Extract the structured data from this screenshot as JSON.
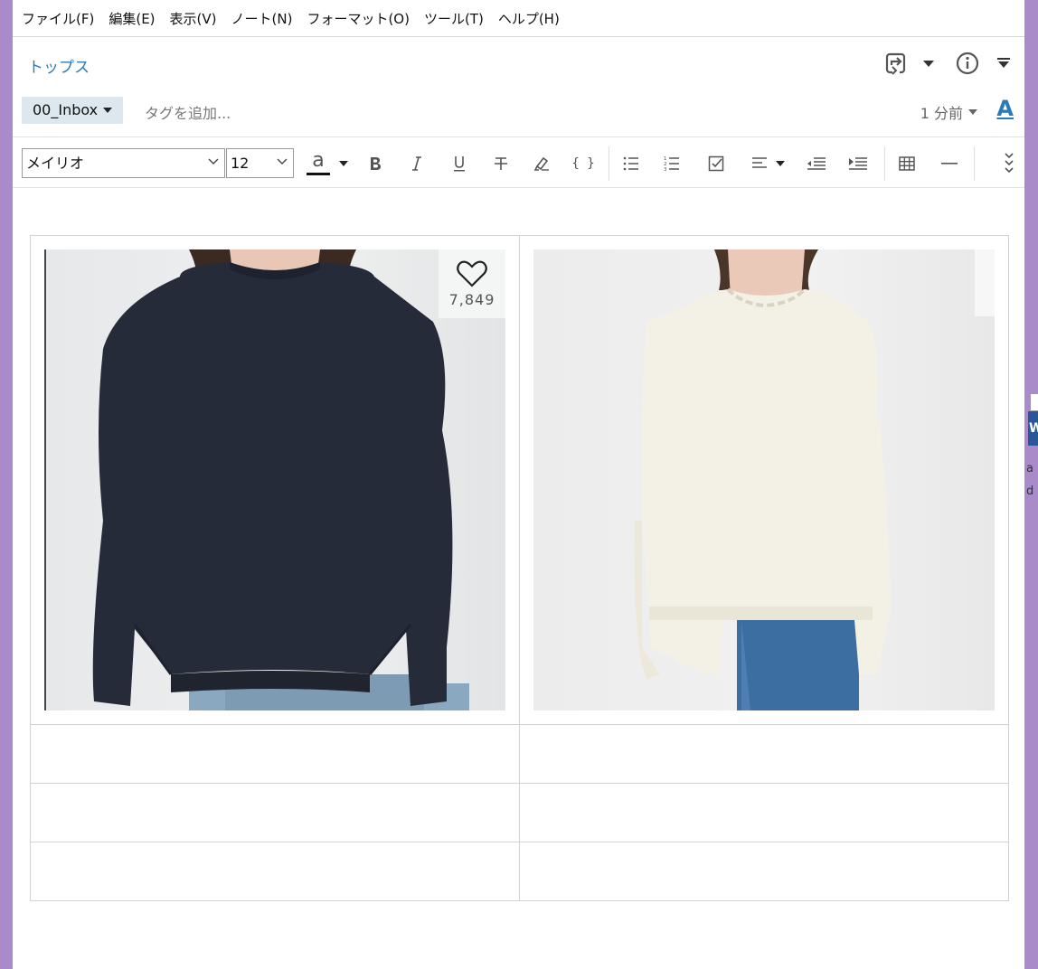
{
  "menu": {
    "items": [
      "ファイル(F)",
      "編集(E)",
      "表示(V)",
      "ノート(N)",
      "フォーマット(O)",
      "ツール(T)",
      "ヘルプ(H)"
    ]
  },
  "header": {
    "notebook": "トップス"
  },
  "tags": {
    "notebook_chip": "00_Inbox",
    "add_tag_placeholder": "タグを追加...",
    "updated": "1 分前",
    "font_icon_letter": "A"
  },
  "toolbar": {
    "font_family": "メイリオ",
    "font_size": "12",
    "text_color_letter": "a",
    "code_label": "{ }"
  },
  "note": {
    "item1_fav_count": "7,849"
  },
  "colors": {
    "accent": "#2c7bb6",
    "desktop": "#a98bc9",
    "tag_chip": "#dde8ee"
  },
  "icons": [
    "share-icon",
    "info-icon",
    "more-caret-icon",
    "bold-icon",
    "italic-icon",
    "underline-icon",
    "strikethrough-icon",
    "highlight-icon",
    "code-icon",
    "bullet-list-icon",
    "numbered-list-icon",
    "checkbox-icon",
    "align-icon",
    "outdent-icon",
    "indent-icon",
    "table-icon",
    "horizontal-rule-icon",
    "expand-icon",
    "heart-icon"
  ]
}
